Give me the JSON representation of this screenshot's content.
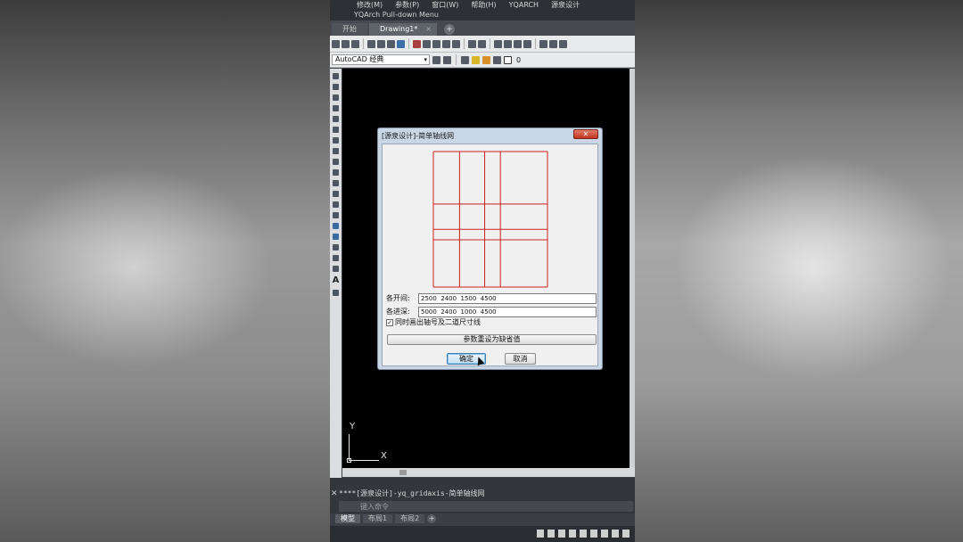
{
  "menu": [
    "修改(M)",
    "参数(P)",
    "窗口(W)",
    "帮助(H)",
    "YQARCH",
    "源泉设计"
  ],
  "subtitle": "YQArch Pull-down Menu",
  "tabs": [
    {
      "label": "开始"
    },
    {
      "label": "Drawing1*",
      "close": "×"
    }
  ],
  "tab_plus": "+",
  "workspace": {
    "value": "AutoCAD 经典",
    "arrow": "▾"
  },
  "layer": {
    "value": "0"
  },
  "palette": {
    "text_tool": "A"
  },
  "ucs": {
    "y": "Y",
    "x": "X"
  },
  "dialog": {
    "title": "[源泉设计]-简单轴线网",
    "close": "✕",
    "fields": {
      "bays": {
        "label": "各开间:",
        "value": "2500  2400  1500  4500"
      },
      "depths": {
        "label": "各进深:",
        "value": "5000  2400  1000  4500"
      }
    },
    "checkbox": {
      "label": "同时画出轴号及二道尺寸线",
      "checked": true,
      "mark": "✓"
    },
    "reset": "参数重设为缺省值",
    "ok": "确定",
    "cancel": "取消"
  },
  "command": {
    "history": "****[源泉设计]-yq_gridaxis-简单轴线网",
    "close": "✕",
    "prompt": "键入命令"
  },
  "layout_tabs": [
    "模型",
    "布局1",
    "布局2"
  ],
  "layout_plus": "+",
  "colors": {
    "grid_line": "#cc1f1f",
    "canvas": "#000000"
  }
}
